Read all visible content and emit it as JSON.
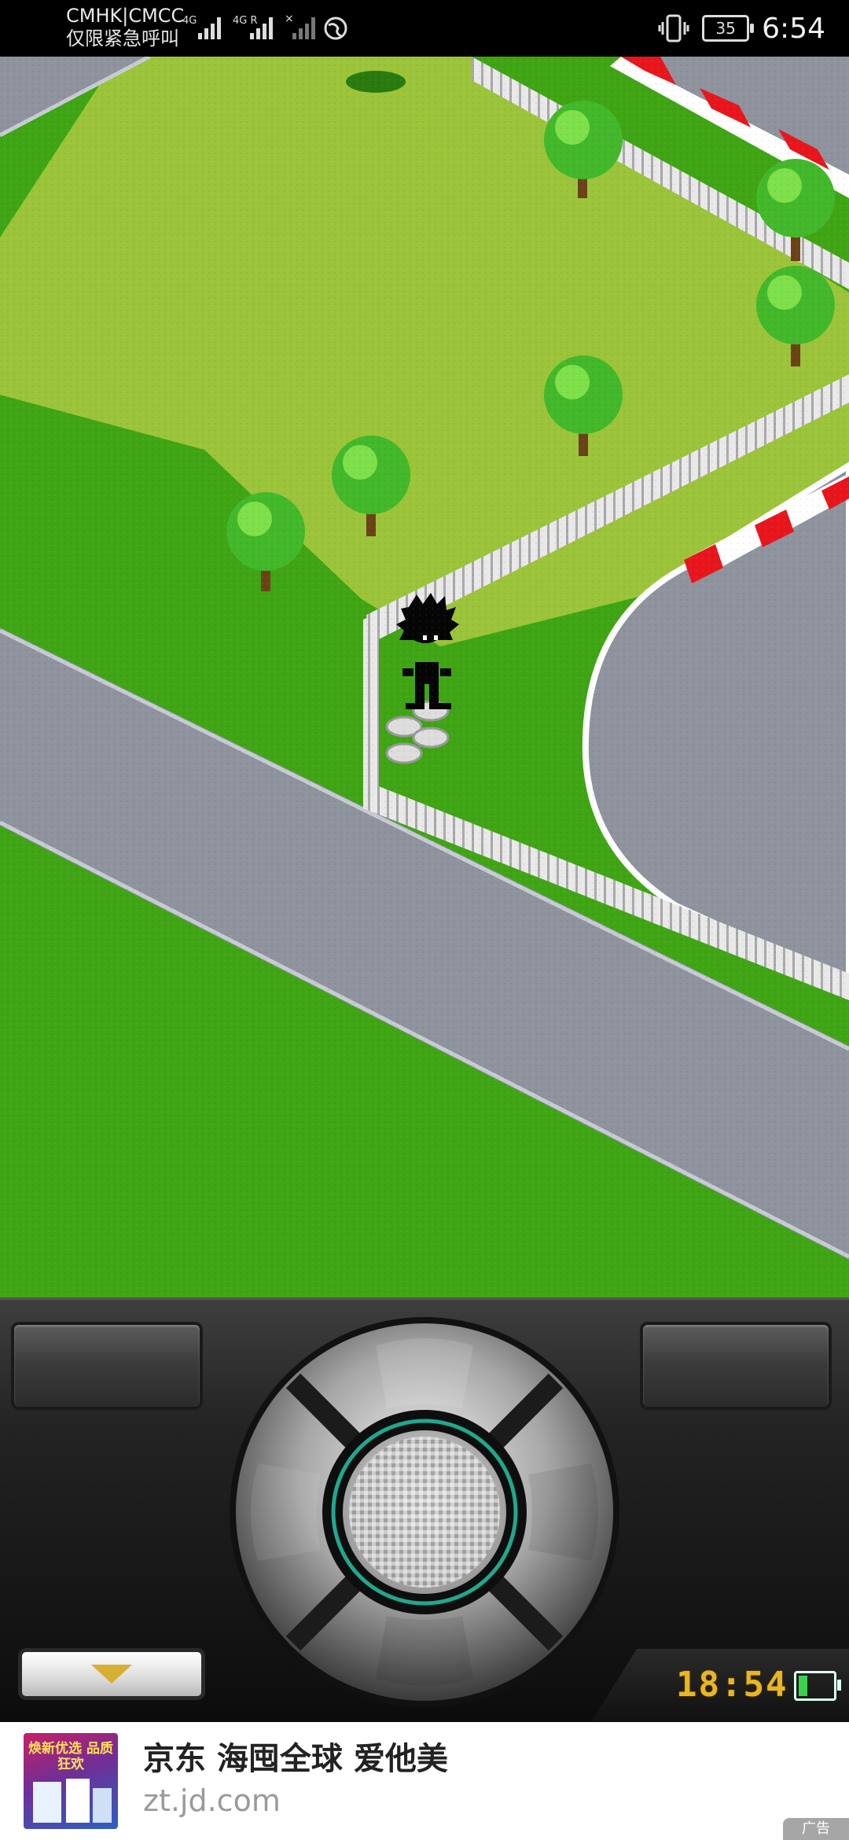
{
  "status_bar": {
    "carrier_line1": "CMHK|CMCC",
    "carrier_line2": "仅限紧急呼叫",
    "battery_level": "35",
    "time": "6:54",
    "icons": [
      "signal-4g-icon",
      "signal-4g-r-icon",
      "no-signal-icon",
      "globe-icon",
      "vibrate-icon",
      "battery-icon"
    ]
  },
  "game": {
    "scene": "isometric race track",
    "clock": "18:54",
    "battery_fill": 0.25
  },
  "controller": {
    "left_softkey": "",
    "right_softkey": "",
    "menu_icon": "triangle-down-icon"
  },
  "ad": {
    "image_text": "焕新优选 品质狂欢",
    "title": "京东 海囤全球 爱他美",
    "url": "zt.jd.com",
    "tag": "广告"
  },
  "colors": {
    "grass_light": "#9cc43a",
    "grass_dark": "#3fa514",
    "road": "#8e939e",
    "curb_red": "#e8161c",
    "clock_yellow": "#e9b623"
  }
}
